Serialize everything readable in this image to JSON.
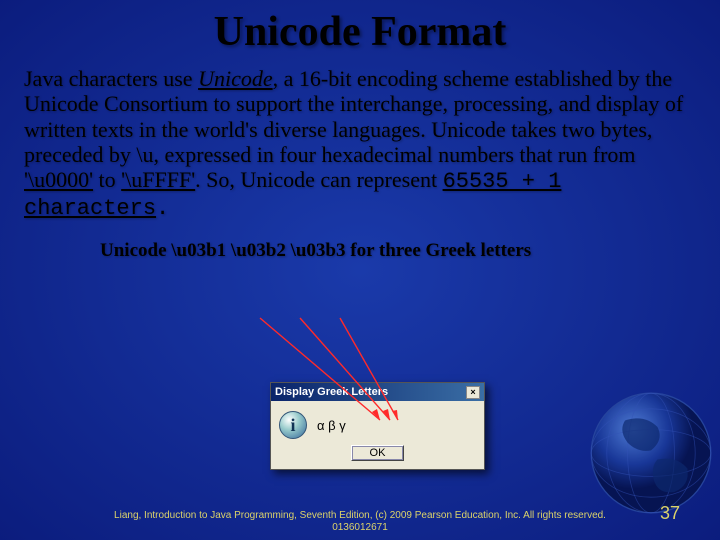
{
  "title": "Unicode Format",
  "body": {
    "p1a": "Java characters use ",
    "p1b": "Unicode",
    "p1c": ", a 16-bit encoding scheme established by the Unicode Consortium to support the interchange, processing, and display of written texts in the world's diverse languages. Unicode takes two bytes, preceded by \\u, expressed in four hexadecimal numbers that run from ",
    "p1d": "'\\u0000'",
    "p1e": " to ",
    "p1f": "'\\uFFFF'",
    "p1g": ". So, Unicode can represent ",
    "p1h": "65535 + 1 characters",
    "p1i": "."
  },
  "subtext": "Unicode \\u03b1 \\u03b2 \\u03b3 for three Greek letters",
  "dialog": {
    "title": "Display Greek Letters",
    "close": "×",
    "info": "i",
    "letters": "α β γ",
    "ok": "OK"
  },
  "footer": "Liang, Introduction to Java Programming, Seventh Edition, (c) 2009 Pearson Education, Inc. All rights reserved. 0136012671",
  "pagenum": "37"
}
